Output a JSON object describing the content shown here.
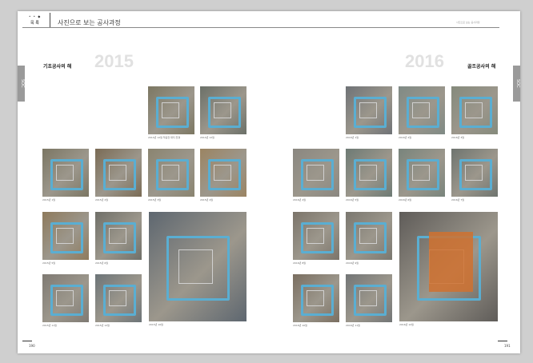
{
  "header": {
    "logo_dots": "• • ◆",
    "logo_text": "목 록",
    "title": "사진으로 보는 공사과정",
    "right_text": "사진으로 보는 공사과정"
  },
  "left": {
    "year": "2015",
    "subtitle": "기초공사의 해",
    "tab_label": "SOC",
    "page_number": "190"
  },
  "right": {
    "year": "2016",
    "subtitle": "골조공사의 해",
    "tab_label": "SOC",
    "page_number": "191"
  },
  "photos": [
    {
      "id": "l1",
      "caption": "2014년 12월 착공전 대지 전경",
      "bg": "#7c7762"
    },
    {
      "id": "l2",
      "caption": "2014년 12월",
      "bg": "#6b7068"
    },
    {
      "id": "l3",
      "caption": "2015년 1월",
      "bg": "#7b7663"
    },
    {
      "id": "l4",
      "caption": "2015년 2월",
      "bg": "#7a6b55"
    },
    {
      "id": "l5",
      "caption": "2015년 3월",
      "bg": "#8a8470"
    },
    {
      "id": "l6",
      "caption": "2015년 4월",
      "bg": "#9b8462"
    },
    {
      "id": "l7",
      "caption": "2015년 5월",
      "bg": "#8e7a5c"
    },
    {
      "id": "l8",
      "caption": "2015년 6월",
      "bg": "#6f6f68"
    },
    {
      "id": "l9",
      "caption": "2015년 10월",
      "bg": "#5e6770"
    },
    {
      "id": "l10",
      "caption": "2015년 11월",
      "bg": "#7f7a73"
    },
    {
      "id": "l11",
      "caption": "2015년 12월",
      "bg": "#6c7478"
    },
    {
      "id": "r1",
      "caption": "2016년 1월",
      "bg": "#6e7276"
    },
    {
      "id": "r2",
      "caption": "2016년 2월",
      "bg": "#7f8a85"
    },
    {
      "id": "r3",
      "caption": "2016년 3월",
      "bg": "#858a7c"
    },
    {
      "id": "r4",
      "caption": "2016년 4월",
      "bg": "#8a8780"
    },
    {
      "id": "r5",
      "caption": "2016년 5월",
      "bg": "#6d7a74"
    },
    {
      "id": "r6",
      "caption": "2016년 6월",
      "bg": "#78847c"
    },
    {
      "id": "r7",
      "caption": "2016년 7월",
      "bg": "#6e746f"
    },
    {
      "id": "r8",
      "caption": "2016년 8월",
      "bg": "#7b746a"
    },
    {
      "id": "r9",
      "caption": "2016년 9월",
      "bg": "#7a776f"
    },
    {
      "id": "r10",
      "caption": "2016년 10월",
      "bg": "#7a6e60"
    },
    {
      "id": "r11",
      "caption": "2016년 11월",
      "bg": "#727576"
    },
    {
      "id": "r12",
      "caption": "2016년 12월",
      "bg": "#5f5c59"
    }
  ]
}
